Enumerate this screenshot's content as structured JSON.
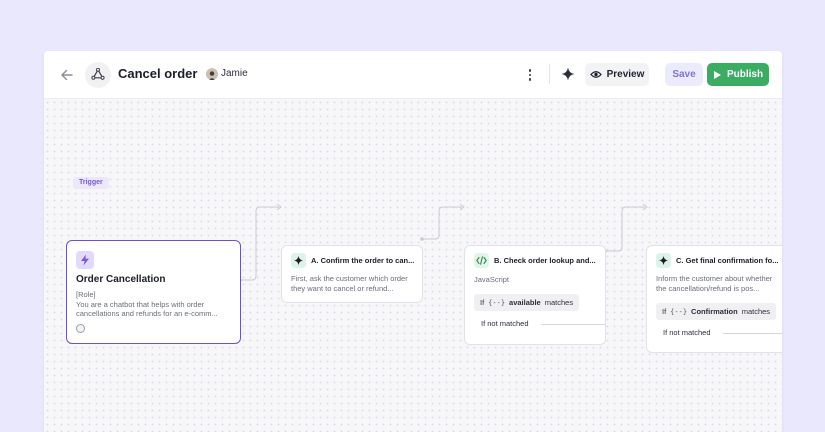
{
  "header": {
    "title": "Cancel order",
    "owner": "Jamie",
    "preview_label": "Preview",
    "save_label": "Save",
    "publish_label": "Publish"
  },
  "colors": {
    "background": "#e9e8fc",
    "accent_purple": "#6d4fd6",
    "publish_green": "#3bad63",
    "save_text": "#7b73d8"
  },
  "icons": {
    "back": "arrow-left-icon",
    "flow": "recycle-icon",
    "more": "kebab-menu-icon",
    "ai": "sparkle-icon",
    "preview": "eye-icon",
    "publish": "play-icon",
    "trigger": "lightning-icon",
    "code": "code-icon"
  },
  "trigger": {
    "tag": "Trigger",
    "title": "Order Cancellation",
    "role": "[Role]",
    "description": "You are a chatbot that helps with order cancellations and refunds for an e-comm..."
  },
  "steps": [
    {
      "title": "A. Confirm the order to can...",
      "description": "First, ask the customer which order they want to cancel or refund..."
    },
    {
      "title": "B. Check order lookup and...",
      "language": "JavaScript",
      "condition": {
        "if": "If",
        "vars": "{--}",
        "field": "available",
        "op": "matches"
      },
      "else": "If not matched"
    },
    {
      "title": "C. Get final confirmation fo...",
      "description": "Inform the customer about whether the cancellation/refund is pos...",
      "condition": {
        "if": "If",
        "vars": "{--}",
        "field": "Confirmation",
        "op": "matches"
      },
      "else": "If not matched"
    }
  ]
}
